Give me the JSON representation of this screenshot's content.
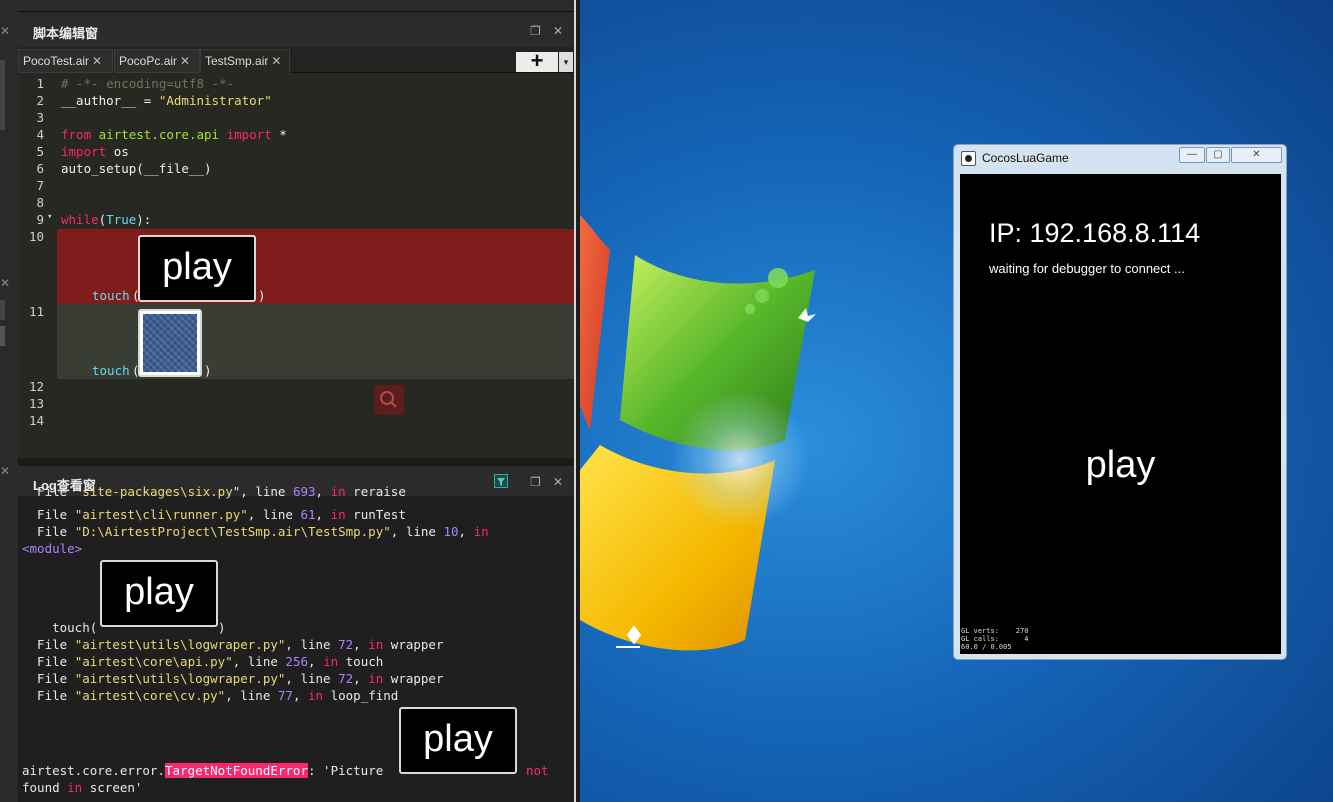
{
  "editor_panel": {
    "title": "脚本编辑窗",
    "tabs": [
      {
        "label": "PocoTest.air",
        "close": "✕"
      },
      {
        "label": "PocoPc.air",
        "close": "✕"
      },
      {
        "label": "TestSmp.air",
        "close": "✕"
      }
    ],
    "add_label": "+",
    "add_caret": "▾",
    "restore_icon": "❐",
    "close_icon": "✕",
    "lines": [
      {
        "n": "1",
        "parts": [
          [
            "c-com",
            "# -*- encoding=utf8 -*-"
          ]
        ]
      },
      {
        "n": "2",
        "parts": [
          [
            "",
            "__author__ = "
          ],
          [
            "c-str",
            "\"Administrator\""
          ]
        ]
      },
      {
        "n": "3",
        "parts": []
      },
      {
        "n": "4",
        "parts": [
          [
            "c-kw",
            "from "
          ],
          [
            "c-fn",
            "airtest.core.api"
          ],
          [
            "c-kw",
            " import "
          ],
          [
            "",
            "*"
          ]
        ]
      },
      {
        "n": "5",
        "parts": [
          [
            "c-kw",
            "import "
          ],
          [
            "",
            "os"
          ]
        ]
      },
      {
        "n": "6",
        "parts": [
          [
            "",
            "auto_setup(__file__)"
          ]
        ]
      },
      {
        "n": "7",
        "parts": []
      },
      {
        "n": "8",
        "parts": []
      },
      {
        "n": "9",
        "fold": "▾",
        "parts": [
          [
            "c-kw",
            "while"
          ],
          [
            "",
            "("
          ],
          [
            "c-bi",
            "True"
          ],
          [
            "",
            "):"
          ]
        ]
      },
      {
        "n": "10",
        "parts": []
      },
      {
        "n": "11",
        "parts": []
      },
      {
        "n": "12",
        "parts": []
      },
      {
        "n": "13",
        "parts": []
      },
      {
        "n": "14",
        "parts": []
      }
    ],
    "touch_call": "touch",
    "paren_open": "(",
    "paren_close": ")",
    "play_thumb_text": "play"
  },
  "log_panel": {
    "title": "Log查看窗",
    "restore_icon": "❐",
    "close_icon": "✕",
    "lines": [
      [
        [
          "",
          "  File \""
        ],
        [
          "s",
          "site-packages\\six.py"
        ],
        [
          "",
          "\", line "
        ],
        [
          "n",
          "693"
        ],
        [
          "",
          ", "
        ],
        [
          "k",
          "in"
        ],
        [
          "",
          " reraise"
        ]
      ],
      [
        [
          "",
          "  File "
        ],
        [
          "s",
          "\"airtest\\cli\\runner.py\""
        ],
        [
          "",
          ", line "
        ],
        [
          "n",
          "61"
        ],
        [
          "",
          ", "
        ],
        [
          "k",
          "in"
        ],
        [
          "",
          " runTest"
        ]
      ],
      [
        [
          "",
          "  File "
        ],
        [
          "s",
          "\"D:\\AirtestProject\\TestSmp.air\\TestSmp.py\""
        ],
        [
          "",
          ", line "
        ],
        [
          "n",
          "10"
        ],
        [
          "",
          ", "
        ],
        [
          "k",
          "in"
        ]
      ],
      [
        [
          "m",
          "<module>"
        ]
      ],
      [
        [
          "",
          "  File "
        ],
        [
          "s",
          "\"airtest\\utils\\logwraper.py\""
        ],
        [
          "",
          ", line "
        ],
        [
          "n",
          "72"
        ],
        [
          "",
          ", "
        ],
        [
          "k",
          "in"
        ],
        [
          "",
          " wrapper"
        ]
      ],
      [
        [
          "",
          "  File "
        ],
        [
          "s",
          "\"airtest\\core\\api.py\""
        ],
        [
          "",
          ", line "
        ],
        [
          "n",
          "256"
        ],
        [
          "",
          ", "
        ],
        [
          "k",
          "in"
        ],
        [
          "",
          " touch"
        ]
      ],
      [
        [
          "",
          "  File "
        ],
        [
          "s",
          "\"airtest\\utils\\logwraper.py\""
        ],
        [
          "",
          ", line "
        ],
        [
          "n",
          "72"
        ],
        [
          "",
          ", "
        ],
        [
          "k",
          "in"
        ],
        [
          "",
          " wrapper"
        ]
      ],
      [
        [
          "",
          "  File "
        ],
        [
          "s",
          "\"airtest\\core\\cv.py\""
        ],
        [
          "",
          ", line "
        ],
        [
          "n",
          "77"
        ],
        [
          "",
          ", "
        ],
        [
          "k",
          "in"
        ],
        [
          "",
          " loop_find"
        ]
      ]
    ],
    "touch_line": "    touch(",
    "touch_close": ")",
    "error_prefix": "airtest.core.error.",
    "error_name": "TargetNotFoundError",
    "error_msg": ": 'Picture ",
    "error_not": "not",
    "error_line2_a": "found ",
    "error_line2_in": "in",
    "error_line2_b": " screen'",
    "play_thumb_text": "play"
  },
  "game_window": {
    "title": "CocosLuaGame",
    "min_icon": "—",
    "max_icon": "▢",
    "close_icon": "✕",
    "ip_text": "IP: 192.168.8.114",
    "waiting_text": "waiting for debugger to connect ...",
    "play_text": "play",
    "stats": "GL verts:    270\nGL calls:      4\n60.0 / 0.005"
  },
  "colors": {
    "error_highlight": "#7f1d1d",
    "current_line": "#3a3d33",
    "error_badge": "#f92672"
  }
}
